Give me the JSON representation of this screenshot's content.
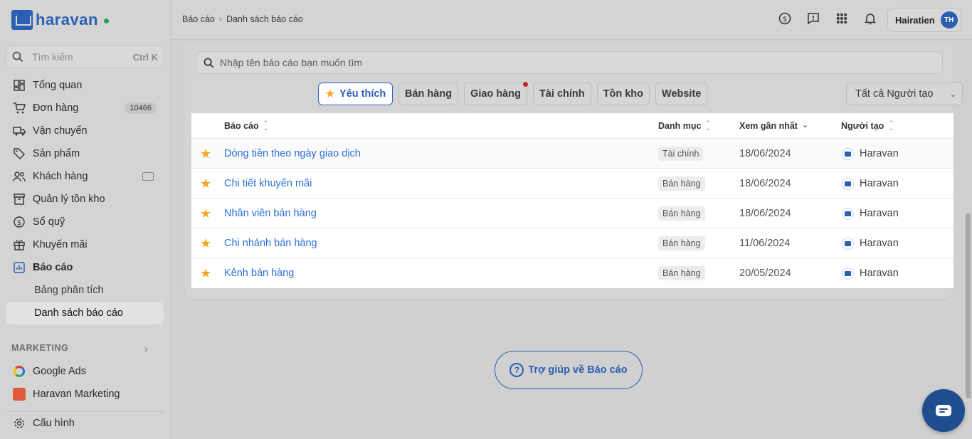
{
  "brand": {
    "name": "haravan"
  },
  "sidebar": {
    "search_placeholder": "Tìm kiếm",
    "search_shortcut": "Ctrl K",
    "items": [
      {
        "label": "Tổng quan",
        "icon": "dashboard-icon"
      },
      {
        "label": "Đơn hàng",
        "icon": "cart-icon",
        "badge": "10466"
      },
      {
        "label": "Vận chuyển",
        "icon": "truck-icon"
      },
      {
        "label": "Sản phẩm",
        "icon": "tag-icon"
      },
      {
        "label": "Khách hàng",
        "icon": "users-icon"
      },
      {
        "label": "Quản lý tồn kho",
        "icon": "warehouse-icon"
      },
      {
        "label": "Sổ quỹ",
        "icon": "dollar-icon"
      },
      {
        "label": "Khuyến mãi",
        "icon": "gift-icon"
      },
      {
        "label": "Báo cáo",
        "icon": "report-icon"
      }
    ],
    "sub_items": [
      "Bảng phân tích",
      "Danh sách báo cáo"
    ],
    "marketing_header": "MARKETING",
    "marketing_items": [
      {
        "label": "Google Ads",
        "icon": "google-icon"
      },
      {
        "label": "Haravan Marketing",
        "icon": "haravan-marketing-icon"
      }
    ],
    "settings_label": "Cấu hình"
  },
  "topbar": {
    "breadcrumb": [
      "Báo cáo",
      "Danh sách báo cáo"
    ],
    "user_name": "Hairatien",
    "user_initials": "TH"
  },
  "reports": {
    "search_placeholder": "Nhập tên báo cáo bạn muốn tìm",
    "creator_filter": "Tất cả Người tạo",
    "filters": [
      "Yêu thích",
      "Bán hàng",
      "Giao hàng",
      "Tài chính",
      "Tồn kho",
      "Website"
    ],
    "columns": [
      "Báo cáo",
      "Danh mục",
      "Xem gần nhất",
      "Người tạo"
    ],
    "rows": [
      {
        "name": "Dòng tiền theo ngày giao dịch",
        "category": "Tài chính",
        "date": "18/06/2024",
        "creator": "Haravan"
      },
      {
        "name": "Chi tiết khuyến mãi",
        "category": "Bán hàng",
        "date": "18/06/2024",
        "creator": "Haravan"
      },
      {
        "name": "Nhân viên bán hàng",
        "category": "Bán hàng",
        "date": "18/06/2024",
        "creator": "Haravan"
      },
      {
        "name": "Chi nhánh bán hàng",
        "category": "Bán hàng",
        "date": "11/06/2024",
        "creator": "Haravan"
      },
      {
        "name": "Kênh bán hàng",
        "category": "Bán hàng",
        "date": "20/05/2024",
        "creator": "Haravan"
      }
    ],
    "help_label": "Trợ giúp về Báo cáo"
  },
  "colors": {
    "accent": "#2b5fb4",
    "star": "#f5a623",
    "link": "#2b6fd6"
  }
}
